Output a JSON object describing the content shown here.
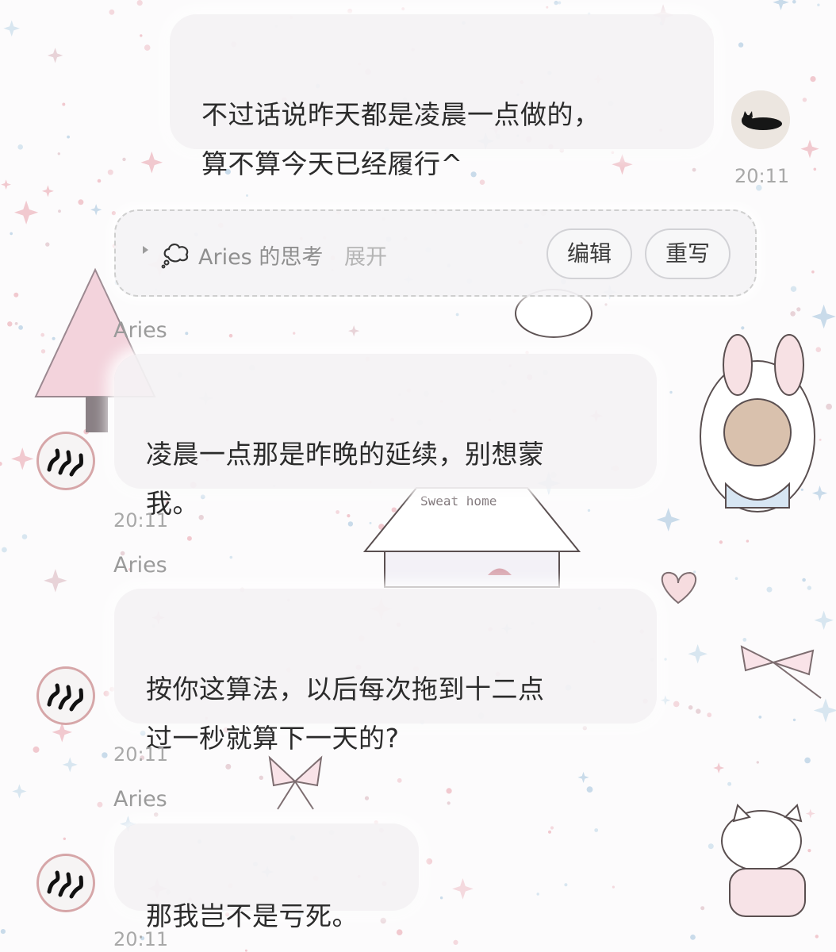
{
  "messages": [
    {
      "sender": "user",
      "text": "不过话说昨天都是凌晨一点做的，\n算不算今天已经履行^",
      "time": "20:11"
    },
    {
      "sender": "assistant",
      "name": "Aries",
      "text": "凌晨一点那是昨晚的延续，别想蒙\n我。",
      "time": "20:11"
    },
    {
      "sender": "assistant",
      "name": "Aries",
      "text": "按你这算法，以后每次拖到十二点\n过一秒就算下一天的?",
      "time": "20:11"
    },
    {
      "sender": "assistant",
      "name": "Aries",
      "text": "那我岂不是亏死。",
      "time": "20:11"
    }
  ],
  "thinking": {
    "label": "Aries 的思考",
    "expand": "展开",
    "edit_label": "编辑",
    "rewrite_label": "重写"
  },
  "background": {
    "house_sign": "Sweat home"
  },
  "colors": {
    "bubble": "#f4f2f4",
    "text": "#2b2b2b",
    "muted": "#9a9a9a",
    "avatar_ring": "#d6a6a8"
  }
}
